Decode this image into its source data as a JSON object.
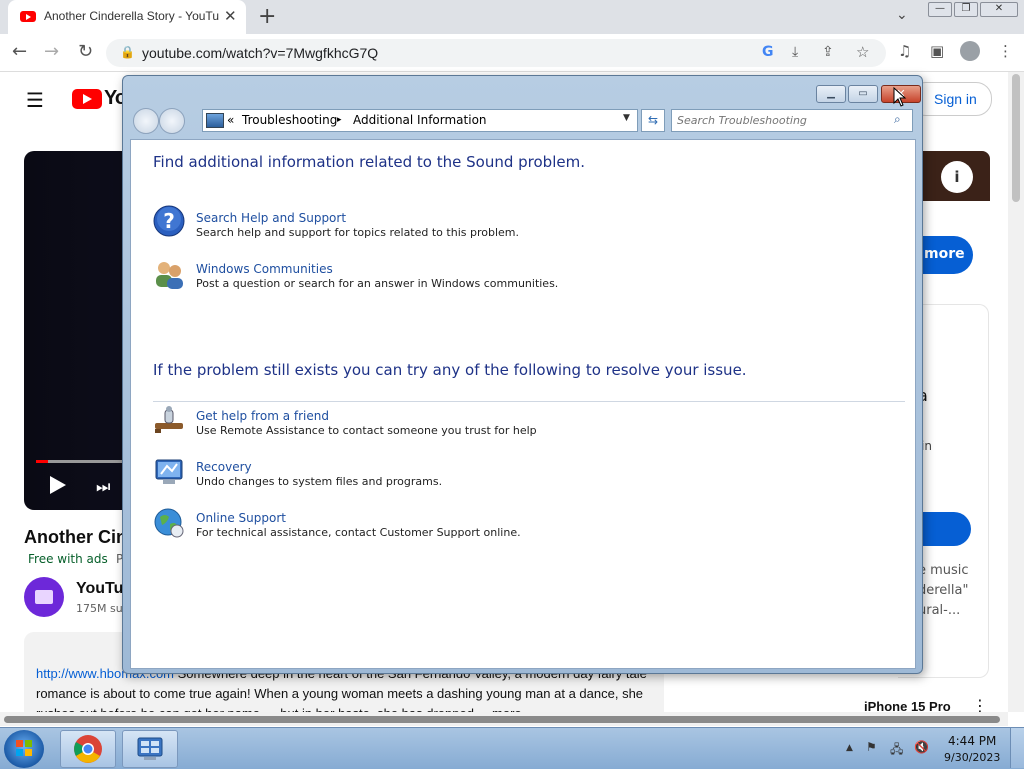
{
  "browser": {
    "tab_title": "Another Cinderella Story - YouTube",
    "tab_close": "✕",
    "new_tab": "+",
    "tab_dropdown": "⌄",
    "url": "youtube.com/watch?v=7MwgfkhcG7Q",
    "nav": {
      "back": "←",
      "forward": "→",
      "reload": "↻"
    },
    "window": {
      "minimize": "—",
      "restore": "❐",
      "close": "✕"
    }
  },
  "youtube": {
    "logo_text": "Yo",
    "sign_in": "Sign in",
    "video_title": "Another Cin",
    "free_with_ads": "Free with ads",
    "free_with_ads_suffix": "P",
    "channel_name": "YouTu",
    "channel_subs": "175M su",
    "description_link": "http://www.hbomax.com",
    "description_text": " Somewhere deep in the heart of the San Fernando Valley, a modern day fairy tale romance is about to come true again! When a young woman meets a dashing young man at a dance, she rushes out before he can get her name — but in her haste, she has dropped ... more",
    "right_more": "more",
    "right_a": "a",
    "right_in": "in",
    "right_text": "e music\nderella\"\nural-...",
    "right_iphone": "iPhone 15 Pro",
    "right_dots": "⋮",
    "info_icon": "i"
  },
  "dialog": {
    "breadcrumb_chevrons": "«",
    "breadcrumb_1": "Troubleshooting",
    "breadcrumb_sep": "▸",
    "breadcrumb_2": "Additional Information",
    "search_placeholder": "Search Troubleshooting",
    "heading_1": "Find additional information related to the Sound problem.",
    "heading_2": "If the problem still exists you can try any of the following to resolve your issue.",
    "items_top": [
      {
        "title": "Search Help and Support",
        "desc": "Search help and support for topics related to this problem.",
        "icon": "help-icon"
      },
      {
        "title": "Windows Communities",
        "desc": "Post a question or search for an answer in Windows communities.",
        "icon": "communities-icon"
      }
    ],
    "items_bottom": [
      {
        "title": "Get help from a friend",
        "desc": "Use Remote Assistance to contact someone you trust for help",
        "icon": "remote-assistance-icon"
      },
      {
        "title": "Recovery",
        "desc": "Undo changes to system files and programs.",
        "icon": "recovery-icon"
      },
      {
        "title": "Online Support",
        "desc": "For technical assistance, contact Customer Support online.",
        "icon": "globe-icon"
      }
    ]
  },
  "taskbar": {
    "time": "4:44 PM",
    "date": "9/30/2023",
    "tray_arrow": "▲"
  }
}
